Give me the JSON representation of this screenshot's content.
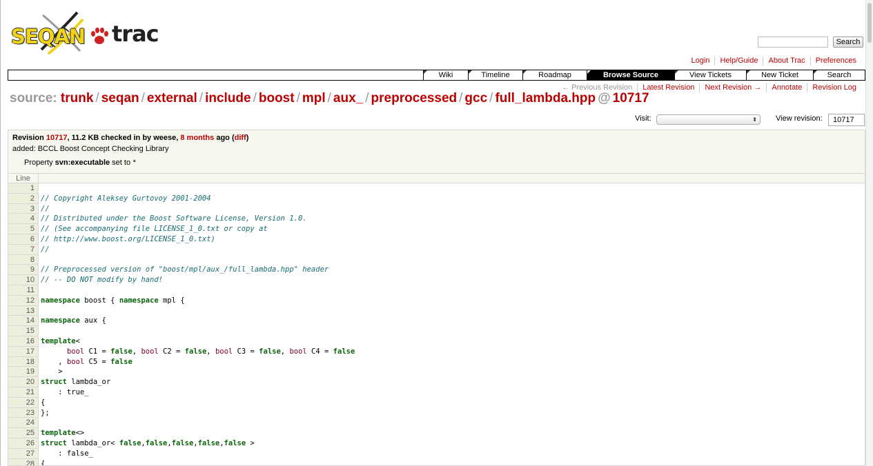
{
  "logo": {
    "seqan": "SEQAN",
    "trac": "trac"
  },
  "search": {
    "button_label": "Search",
    "value": ""
  },
  "metanav": [
    "Login",
    "Help/Guide",
    "About Trac",
    "Preferences"
  ],
  "mainnav": {
    "items": [
      "Wiki",
      "Timeline",
      "Roadmap",
      "Browse Source",
      "View Tickets",
      "New Ticket",
      "Search"
    ],
    "active": "Browse Source"
  },
  "ctxtnav": {
    "previous_revision": "← Previous Revision",
    "latest_revision": "Latest Revision",
    "next_revision": "Next Revision →",
    "annotate": "Annotate",
    "revision_log": "Revision Log"
  },
  "path": {
    "label": "source:",
    "segments": [
      "trunk",
      "seqan",
      "external",
      "include",
      "boost",
      "mpl",
      "aux_",
      "preprocessed",
      "gcc",
      "full_lambda.hpp"
    ],
    "at": "@",
    "revision": "10717"
  },
  "visit": {
    "label": "Visit:",
    "selected": ""
  },
  "view_revision": {
    "label": "View revision:",
    "value": "10717"
  },
  "info": {
    "revision_prefix": "Revision ",
    "revision": "10717",
    "size_text": ", 11.2 KB checked in by weese, ",
    "age": "8 months",
    "age_suffix": " ago (",
    "diff": "diff",
    "close": ")",
    "message": "added: BCCL Boost Concept Checking Library",
    "property_prefix": "Property ",
    "property_name": "svn:executable",
    "property_mid": " set to ",
    "property_value": "*"
  },
  "code": {
    "line_header": "Line",
    "lines": [
      [],
      [
        [
          "c",
          "// Copyright Aleksey Gurtovoy 2001-2004"
        ]
      ],
      [
        [
          "c",
          "//"
        ]
      ],
      [
        [
          "c",
          "// Distributed under the Boost Software License, Version 1.0."
        ]
      ],
      [
        [
          "c",
          "// (See accompanying file LICENSE_1_0.txt or copy at"
        ]
      ],
      [
        [
          "c",
          "// http://www.boost.org/LICENSE_1_0.txt)"
        ]
      ],
      [
        [
          "c",
          "//"
        ]
      ],
      [],
      [
        [
          "c",
          "// Preprocessed version of \"boost/mpl/aux_/full_lambda.hpp\" header"
        ]
      ],
      [
        [
          "c",
          "// -- DO NOT modify by hand!"
        ]
      ],
      [],
      [
        [
          "k",
          "namespace"
        ],
        [
          "p",
          " boost { "
        ],
        [
          "k",
          "namespace"
        ],
        [
          "p",
          " mpl {"
        ]
      ],
      [],
      [
        [
          "k",
          "namespace"
        ],
        [
          "p",
          " aux {"
        ]
      ],
      [],
      [
        [
          "k",
          "template"
        ],
        [
          "p",
          "<"
        ]
      ],
      [
        [
          "p",
          "      "
        ],
        [
          "t",
          "bool"
        ],
        [
          "p",
          " C1 = "
        ],
        [
          "k",
          "false"
        ],
        [
          "p",
          ", "
        ],
        [
          "t",
          "bool"
        ],
        [
          "p",
          " C2 = "
        ],
        [
          "k",
          "false"
        ],
        [
          "p",
          ", "
        ],
        [
          "t",
          "bool"
        ],
        [
          "p",
          " C3 = "
        ],
        [
          "k",
          "false"
        ],
        [
          "p",
          ", "
        ],
        [
          "t",
          "bool"
        ],
        [
          "p",
          " C4 = "
        ],
        [
          "k",
          "false"
        ]
      ],
      [
        [
          "p",
          "    , "
        ],
        [
          "t",
          "bool"
        ],
        [
          "p",
          " C5 = "
        ],
        [
          "k",
          "false"
        ]
      ],
      [
        [
          "p",
          "    >"
        ]
      ],
      [
        [
          "k",
          "struct"
        ],
        [
          "p",
          " lambda_or"
        ]
      ],
      [
        [
          "p",
          "    : true_"
        ]
      ],
      [
        [
          "p",
          "{"
        ]
      ],
      [
        [
          "p",
          "};"
        ]
      ],
      [],
      [
        [
          "k",
          "template"
        ],
        [
          "p",
          "<>"
        ]
      ],
      [
        [
          "k",
          "struct"
        ],
        [
          "p",
          " lambda_or< "
        ],
        [
          "k",
          "false"
        ],
        [
          "p",
          ","
        ],
        [
          "k",
          "false"
        ],
        [
          "p",
          ","
        ],
        [
          "k",
          "false"
        ],
        [
          "p",
          ","
        ],
        [
          "k",
          "false"
        ],
        [
          "p",
          ","
        ],
        [
          "k",
          "false"
        ],
        [
          "p",
          " >"
        ]
      ],
      [
        [
          "p",
          "    : false_"
        ]
      ],
      [
        [
          "p",
          "{"
        ]
      ]
    ]
  }
}
